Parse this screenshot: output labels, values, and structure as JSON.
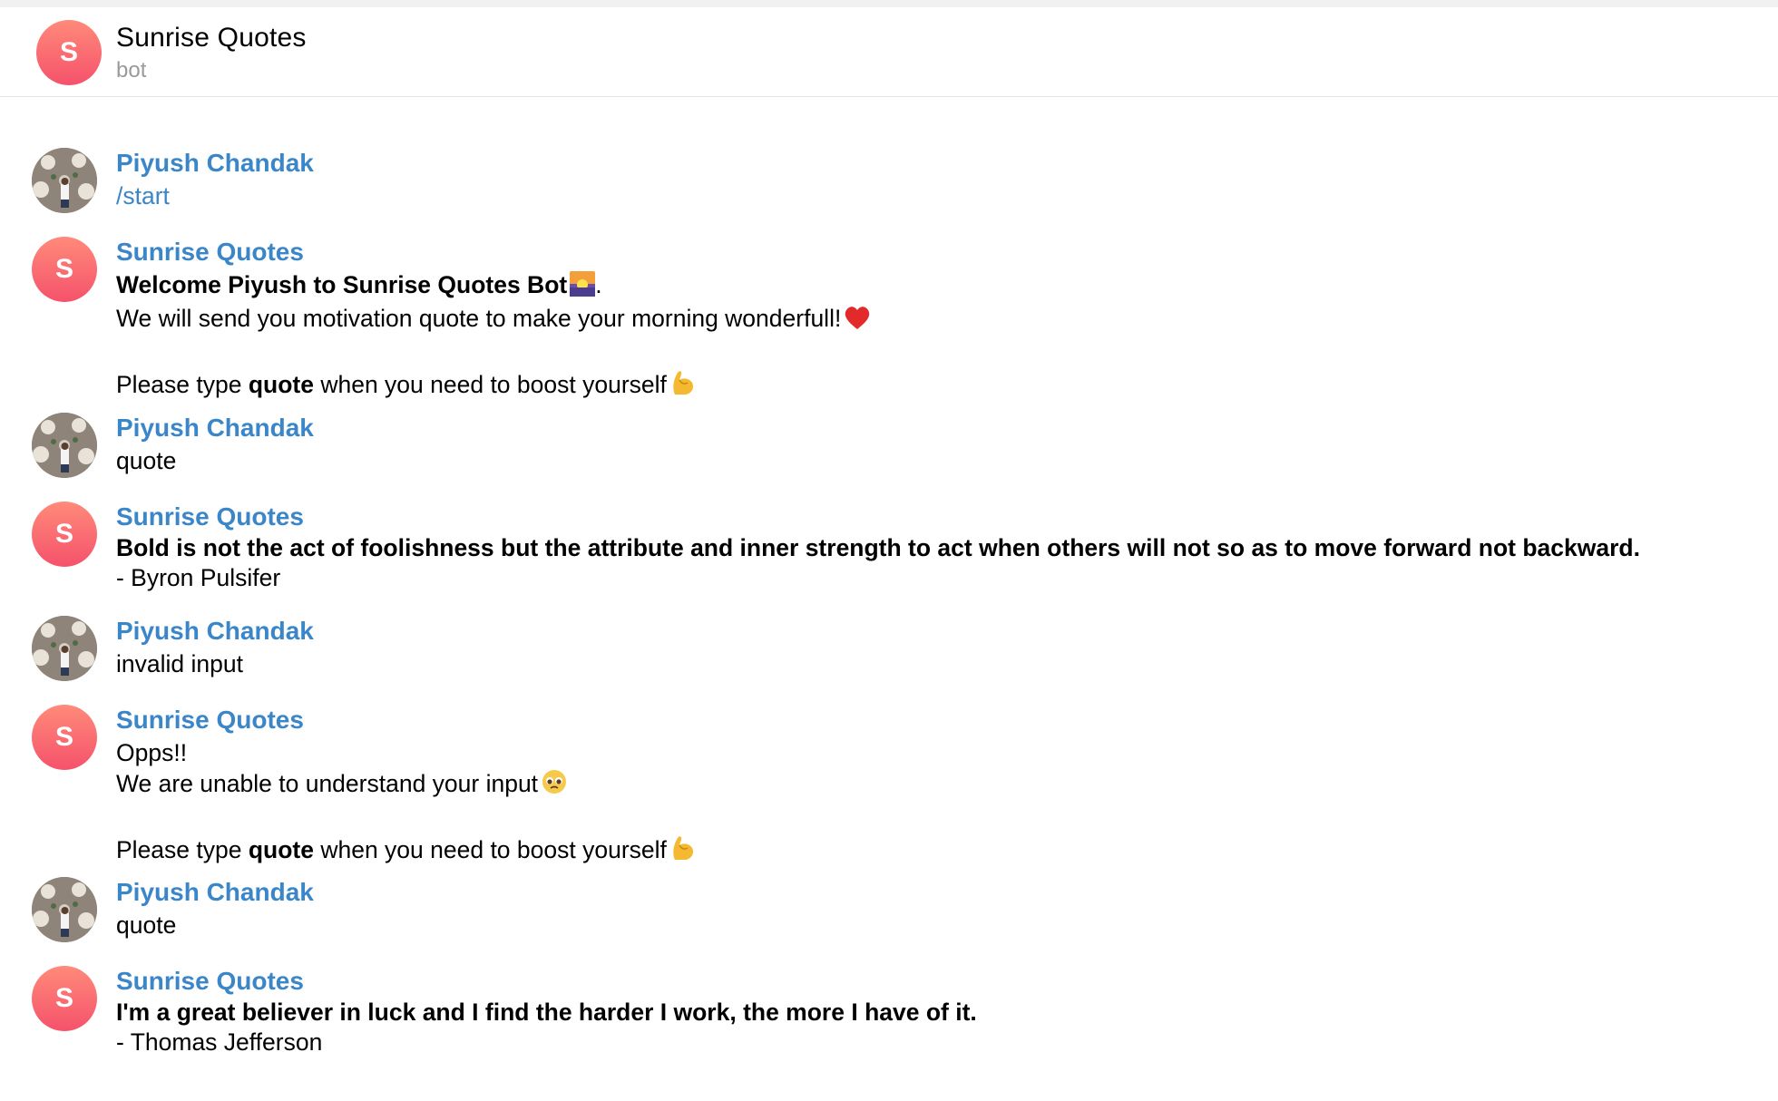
{
  "header": {
    "avatar_letter": "S",
    "title": "Sunrise Quotes",
    "subtitle": "bot"
  },
  "messages": [
    {
      "sender": "Piyush Chandak",
      "text": "/start"
    },
    {
      "sender": "Sunrise Quotes",
      "avatar_letter": "S",
      "welcome_bold": "Welcome Piyush to Sunrise Quotes Bot",
      "welcome_suffix": ".",
      "line2": "We will send you motivation quote to make your morning wonderfull!",
      "prompt_pre": "Please type ",
      "prompt_bold": "quote",
      "prompt_post": " when you need to boost yourself"
    },
    {
      "sender": "Piyush Chandak",
      "text": "quote"
    },
    {
      "sender": "Sunrise Quotes",
      "avatar_letter": "S",
      "quote": "Bold is not the act of foolishness but the attribute and inner strength to act when others will not so as to move forward not backward.",
      "author": "- Byron Pulsifer"
    },
    {
      "sender": "Piyush Chandak",
      "text": "invalid input"
    },
    {
      "sender": "Sunrise Quotes",
      "avatar_letter": "S",
      "line1": "Opps!!",
      "line2": "We are unable to understand your input",
      "prompt_pre": "Please type ",
      "prompt_bold": "quote",
      "prompt_post": " when you need to boost yourself"
    },
    {
      "sender": "Piyush Chandak",
      "text": "quote"
    },
    {
      "sender": "Sunrise Quotes",
      "avatar_letter": "S",
      "quote": "I'm a great believer in luck and I find the harder I work, the more I have of it.",
      "author": "- Thomas Jefferson"
    }
  ],
  "icons": {
    "sunrise": "sunrise-emoji",
    "heart": "red-heart-emoji",
    "muscle": "flexed-biceps-emoji",
    "pleading": "pleading-face-emoji"
  },
  "colors": {
    "sender_name": "#3a86c8",
    "bot_avatar_top": "#ff8a7a",
    "bot_avatar_bottom": "#f5526b",
    "subtitle": "#9a9a9a"
  }
}
